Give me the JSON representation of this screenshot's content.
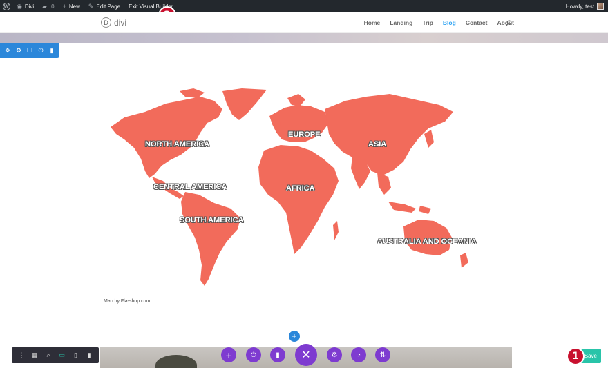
{
  "admin_bar": {
    "site_name": "Divi",
    "comment_count": "0",
    "new_label": "New",
    "edit_page_label": "Edit Page",
    "exit_builder_label": "Exit Visual Builder",
    "greeting": "Howdy, test"
  },
  "header": {
    "logo_letter": "D",
    "logo_text": "divi",
    "nav": [
      "Home",
      "Landing",
      "Trip",
      "Blog",
      "Contact",
      "About"
    ],
    "active_nav": "Blog"
  },
  "map": {
    "regions": [
      "NORTH AMERICA",
      "CENTRAL AMERICA",
      "SOUTH AMERICA",
      "EUROPE",
      "AFRICA",
      "ASIA",
      "AUSTRALIA AND OCEANIA"
    ],
    "credit": "Map by Fla-shop.com",
    "land_color": "#f26b5b"
  },
  "builder": {
    "save_label": "Save",
    "add_row_symbol": "+",
    "close_symbol": "✕"
  },
  "annotations": {
    "step_1": "1",
    "step_2": "2"
  },
  "colors": {
    "admin_bar": "#23282d",
    "section_toolbar": "#2b87da",
    "purple": "#7e3bd0",
    "save": "#29c4a9",
    "badge": "#c8102e",
    "nav_active": "#2ea3f2"
  }
}
